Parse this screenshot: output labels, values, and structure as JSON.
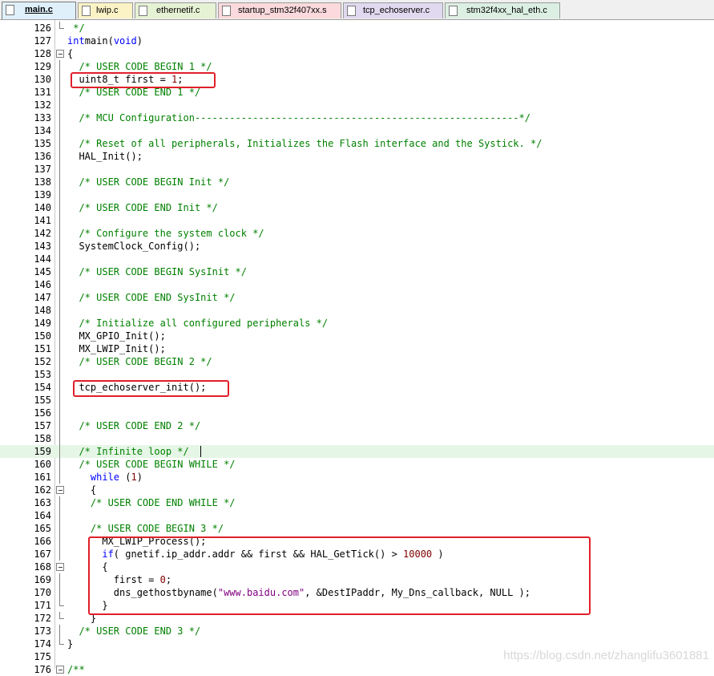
{
  "tabs": [
    {
      "label": "main.c",
      "color": "#dff0fb",
      "active": true
    },
    {
      "label": "lwip.c",
      "color": "#fbf3c6",
      "active": false
    },
    {
      "label": "ethernetif.c",
      "color": "#e6f2d4",
      "active": false
    },
    {
      "label": "startup_stm32f407xx.s",
      "color": "#fbd9dc",
      "active": false
    },
    {
      "label": "tcp_echoserver.c",
      "color": "#e1d9f0",
      "active": false
    },
    {
      "label": "stm32f4xx_hal_eth.c",
      "color": "#dcefe3",
      "active": false
    }
  ],
  "lines": [
    {
      "n": "126",
      "fold": "end",
      "t": [
        [
          "c",
          " */"
        ]
      ]
    },
    {
      "n": "127",
      "fold": "",
      "t": [
        [
          "k",
          "int"
        ],
        [
          "",
          "main("
        ],
        [
          "k",
          "void"
        ],
        [
          "",
          ")"
        ]
      ]
    },
    {
      "n": "128",
      "fold": "box",
      "t": [
        [
          "",
          "{"
        ]
      ]
    },
    {
      "n": "129",
      "fold": "bar",
      "t": [
        [
          "c",
          "  /* USER CODE BEGIN 1 */"
        ]
      ]
    },
    {
      "n": "130",
      "fold": "bar",
      "t": [
        [
          "",
          "  uint8_t first = "
        ],
        [
          "n",
          "1"
        ],
        [
          "",
          ";"
        ]
      ]
    },
    {
      "n": "131",
      "fold": "bar",
      "t": [
        [
          "c",
          "  /* USER CODE END 1 */"
        ]
      ]
    },
    {
      "n": "132",
      "fold": "bar",
      "t": [
        [
          "",
          ""
        ]
      ]
    },
    {
      "n": "133",
      "fold": "bar",
      "t": [
        [
          "c",
          "  /* MCU Configuration--------------------------------------------------------*/"
        ]
      ]
    },
    {
      "n": "134",
      "fold": "bar",
      "t": [
        [
          "",
          ""
        ]
      ]
    },
    {
      "n": "135",
      "fold": "bar",
      "t": [
        [
          "c",
          "  /* Reset of all peripherals, Initializes the Flash interface and the Systick. */"
        ]
      ]
    },
    {
      "n": "136",
      "fold": "bar",
      "t": [
        [
          "",
          "  HAL_Init();"
        ]
      ]
    },
    {
      "n": "137",
      "fold": "bar",
      "t": [
        [
          "",
          ""
        ]
      ]
    },
    {
      "n": "138",
      "fold": "bar",
      "t": [
        [
          "c",
          "  /* USER CODE BEGIN Init */"
        ]
      ]
    },
    {
      "n": "139",
      "fold": "bar",
      "t": [
        [
          "",
          ""
        ]
      ]
    },
    {
      "n": "140",
      "fold": "bar",
      "t": [
        [
          "c",
          "  /* USER CODE END Init */"
        ]
      ]
    },
    {
      "n": "141",
      "fold": "bar",
      "t": [
        [
          "",
          ""
        ]
      ]
    },
    {
      "n": "142",
      "fold": "bar",
      "t": [
        [
          "c",
          "  /* Configure the system clock */"
        ]
      ]
    },
    {
      "n": "143",
      "fold": "bar",
      "t": [
        [
          "",
          "  SystemClock_Config();"
        ]
      ]
    },
    {
      "n": "144",
      "fold": "bar",
      "t": [
        [
          "",
          ""
        ]
      ]
    },
    {
      "n": "145",
      "fold": "bar",
      "t": [
        [
          "c",
          "  /* USER CODE BEGIN SysInit */"
        ]
      ]
    },
    {
      "n": "146",
      "fold": "bar",
      "t": [
        [
          "",
          ""
        ]
      ]
    },
    {
      "n": "147",
      "fold": "bar",
      "t": [
        [
          "c",
          "  /* USER CODE END SysInit */"
        ]
      ]
    },
    {
      "n": "148",
      "fold": "bar",
      "t": [
        [
          "",
          ""
        ]
      ]
    },
    {
      "n": "149",
      "fold": "bar",
      "t": [
        [
          "c",
          "  /* Initialize all configured peripherals */"
        ]
      ]
    },
    {
      "n": "150",
      "fold": "bar",
      "t": [
        [
          "",
          "  MX_GPIO_Init();"
        ]
      ]
    },
    {
      "n": "151",
      "fold": "bar",
      "t": [
        [
          "",
          "  MX_LWIP_Init();"
        ]
      ]
    },
    {
      "n": "152",
      "fold": "bar",
      "t": [
        [
          "c",
          "  /* USER CODE BEGIN 2 */"
        ]
      ]
    },
    {
      "n": "153",
      "fold": "bar",
      "t": [
        [
          "",
          ""
        ]
      ]
    },
    {
      "n": "154",
      "fold": "bar",
      "t": [
        [
          "",
          "  tcp_echoserver_init();"
        ]
      ]
    },
    {
      "n": "155",
      "fold": "bar",
      "t": [
        [
          "",
          ""
        ]
      ]
    },
    {
      "n": "156",
      "fold": "bar",
      "t": [
        [
          "",
          ""
        ]
      ]
    },
    {
      "n": "157",
      "fold": "bar",
      "t": [
        [
          "c",
          "  /* USER CODE END 2 */"
        ]
      ]
    },
    {
      "n": "158",
      "fold": "bar",
      "t": [
        [
          "",
          ""
        ]
      ]
    },
    {
      "n": "159",
      "fold": "bar",
      "hl": true,
      "t": [
        [
          "c",
          "  /* Infinite loop */"
        ]
      ]
    },
    {
      "n": "160",
      "fold": "bar",
      "t": [
        [
          "c",
          "  /* USER CODE BEGIN WHILE */"
        ]
      ]
    },
    {
      "n": "161",
      "fold": "bar",
      "t": [
        [
          "k",
          "    while"
        ],
        [
          "",
          " ("
        ],
        [
          "n",
          "1"
        ],
        [
          "",
          ")"
        ]
      ]
    },
    {
      "n": "162",
      "fold": "box",
      "t": [
        [
          "",
          "    {"
        ]
      ]
    },
    {
      "n": "163",
      "fold": "bar",
      "t": [
        [
          "c",
          "    /* USER CODE END WHILE */"
        ]
      ]
    },
    {
      "n": "164",
      "fold": "bar",
      "t": [
        [
          "",
          ""
        ]
      ]
    },
    {
      "n": "165",
      "fold": "bar",
      "t": [
        [
          "c",
          "    /* USER CODE BEGIN 3 */"
        ]
      ]
    },
    {
      "n": "166",
      "fold": "bar",
      "t": [
        [
          "",
          "      MX_LWIP_Process();"
        ]
      ]
    },
    {
      "n": "167",
      "fold": "bar",
      "t": [
        [
          "k",
          "      if"
        ],
        [
          "",
          "( gnetif.ip_addr.addr && first && HAL_GetTick() > "
        ],
        [
          "n",
          "10000"
        ],
        [
          "",
          " )"
        ]
      ]
    },
    {
      "n": "168",
      "fold": "box",
      "t": [
        [
          "",
          "      {"
        ]
      ]
    },
    {
      "n": "169",
      "fold": "bar",
      "t": [
        [
          "",
          "        first = "
        ],
        [
          "n",
          "0"
        ],
        [
          "",
          ";"
        ]
      ]
    },
    {
      "n": "170",
      "fold": "bar",
      "t": [
        [
          "",
          "        dns_gethostbyname("
        ],
        [
          "s",
          "\"www.baidu.com\""
        ],
        [
          "",
          ", &DestIPaddr, My_Dns_callback, NULL );"
        ]
      ]
    },
    {
      "n": "171",
      "fold": "end",
      "t": [
        [
          "",
          "      }"
        ]
      ]
    },
    {
      "n": "172",
      "fold": "end",
      "t": [
        [
          "",
          "    }"
        ]
      ]
    },
    {
      "n": "173",
      "fold": "bar",
      "t": [
        [
          "c",
          "  /* USER CODE END 3 */"
        ]
      ]
    },
    {
      "n": "174",
      "fold": "end",
      "t": [
        [
          "",
          "}"
        ]
      ]
    },
    {
      "n": "175",
      "fold": "",
      "t": [
        [
          "",
          ""
        ]
      ]
    },
    {
      "n": "176",
      "fold": "box",
      "t": [
        [
          "c",
          "/**"
        ]
      ]
    }
  ],
  "watermark": "https://blog.csdn.net/zhanglifu3601881"
}
